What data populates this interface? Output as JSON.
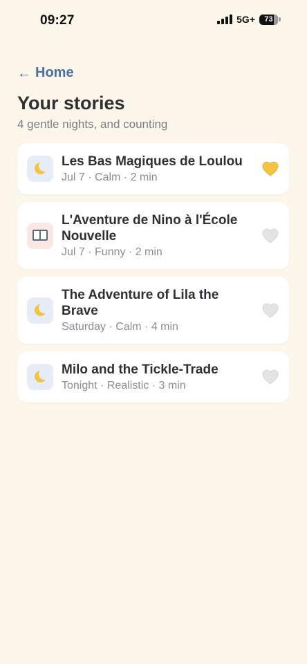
{
  "status_bar": {
    "time": "09:27",
    "network": "5G+",
    "battery": "73"
  },
  "nav": {
    "back_arrow": "←",
    "back_label": "Home"
  },
  "header": {
    "title": "Your stories",
    "subtitle": "4 gentle nights, and counting"
  },
  "stories": [
    {
      "icon": "moon-icon",
      "title": "Les Bas Magiques de Loulou",
      "meta": "Jul 7 · Calm · 2 min",
      "favorited": true
    },
    {
      "icon": "book-icon",
      "title": "L'Aventure de Nino à l'École Nouvelle",
      "meta": "Jul 7 · Funny · 2 min",
      "favorited": false
    },
    {
      "icon": "moon-icon",
      "title": "The Adventure of Lila the Brave",
      "meta": "Saturday · Calm · 4 min",
      "favorited": false
    },
    {
      "icon": "moon-icon",
      "title": "Milo and the Tickle-Trade",
      "meta": "Tonight · Realistic · 3 min",
      "favorited": false
    }
  ],
  "colors": {
    "background": "#fdf6ea",
    "accent": "#4a6fa5",
    "heart_favorited": "#f5c542",
    "heart_default": "#e2e2e2"
  }
}
